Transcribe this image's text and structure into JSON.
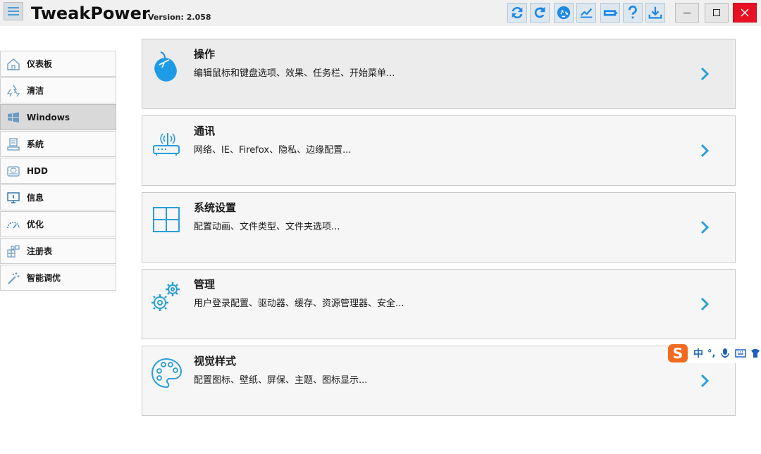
{
  "app": {
    "title": "TweakPower",
    "version": "Version: 2.058"
  },
  "toolbar": [
    {
      "name": "refresh-icon"
    },
    {
      "name": "redo-icon"
    },
    {
      "name": "recycle-icon"
    },
    {
      "name": "chart-icon"
    },
    {
      "name": "battery-icon"
    },
    {
      "name": "help-icon"
    },
    {
      "name": "download-icon"
    }
  ],
  "window_controls": [
    "minimize",
    "maximize",
    "close"
  ],
  "sidebar": {
    "items": [
      {
        "label": "仪表板",
        "icon": "home-icon"
      },
      {
        "label": "清洁",
        "icon": "recycle-icon"
      },
      {
        "label": "Windows",
        "icon": "windows-icon",
        "active": true
      },
      {
        "label": "系统",
        "icon": "system-icon"
      },
      {
        "label": "HDD",
        "icon": "hdd-icon"
      },
      {
        "label": "信息",
        "icon": "info-icon"
      },
      {
        "label": "优化",
        "icon": "gauge-icon"
      },
      {
        "label": "注册表",
        "icon": "registry-icon"
      },
      {
        "label": "智能调优",
        "icon": "magic-wand-icon"
      }
    ]
  },
  "cards": [
    {
      "title": "操作",
      "desc": "编辑鼠标和键盘选项、效果、任务栏、开始菜单...",
      "icon": "mouse-icon"
    },
    {
      "title": "通讯",
      "desc": "网络、IE、Firefox、隐私、边缘配置...",
      "icon": "router-icon"
    },
    {
      "title": "系统设置",
      "desc": "配置动画、文件类型、文件夹选项...",
      "icon": "windows-logo-icon"
    },
    {
      "title": "管理",
      "desc": "用户登录配置、驱动器、缓存、资源管理器、安全...",
      "icon": "gears-icon"
    },
    {
      "title": "视觉样式",
      "desc": "配置图标、壁纸、屏保、主题、图标显示...",
      "icon": "palette-icon"
    }
  ],
  "ime": {
    "logo": "S",
    "lang": "中",
    "punct": "°,"
  },
  "colors": {
    "accent": "#2a9fd8",
    "icon_blue": "#1e88e5",
    "close_red": "#e81123",
    "ime_orange": "#f26a21"
  }
}
